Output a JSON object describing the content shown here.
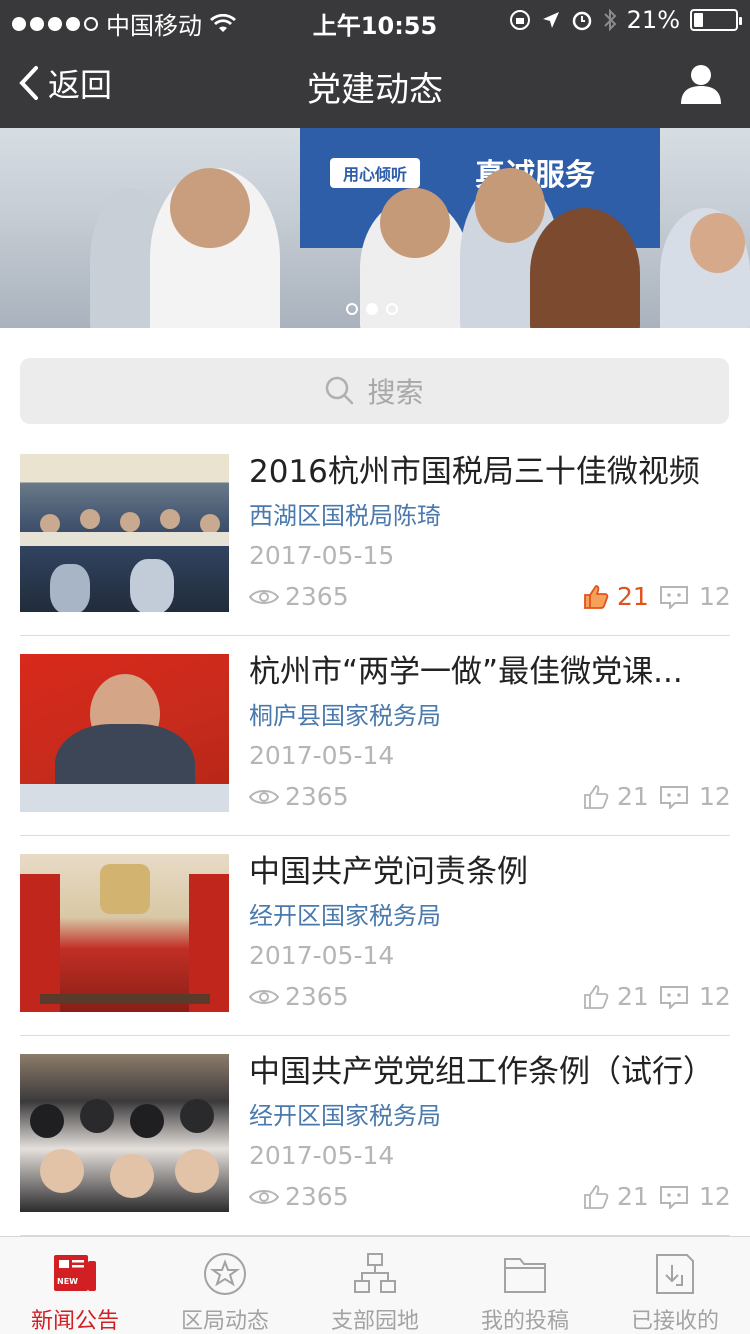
{
  "status_bar": {
    "carrier": "中国移动",
    "time": "上午10:55",
    "battery": "21%",
    "battery_level": 0.21
  },
  "nav": {
    "back_label": "返回",
    "title": "党建动态",
    "icons": {
      "back": "chevron-left-icon",
      "user": "user-icon"
    }
  },
  "banner": {
    "slide_count": 3,
    "active_index": 1,
    "sign_text": "真诚服务",
    "sign_small": "用心倾听"
  },
  "search": {
    "placeholder": "搜索",
    "icon": "search-icon"
  },
  "news": [
    {
      "title": "2016杭州市国税局三十佳微视频",
      "source": "西湖区国税局陈琦",
      "date": "2017-05-15",
      "views": "2365",
      "likes": "21",
      "comments": "12",
      "liked": true
    },
    {
      "title": "杭州市“两学一做”最佳微党课...",
      "source": "桐庐县国家税务局",
      "date": "2017-05-14",
      "views": "2365",
      "likes": "21",
      "comments": "12",
      "liked": false
    },
    {
      "title": "中国共产党问责条例",
      "source": "经开区国家税务局",
      "date": "2017-05-14",
      "views": "2365",
      "likes": "21",
      "comments": "12",
      "liked": false
    },
    {
      "title": "中国共产党党组工作条例（试行）",
      "source": "经开区国家税务局",
      "date": "2017-05-14",
      "views": "2365",
      "likes": "21",
      "comments": "12",
      "liked": false
    }
  ],
  "tabs": [
    {
      "label": "新闻公告",
      "icon": "news-icon",
      "active": true,
      "badge": "NEW"
    },
    {
      "label": "区局动态",
      "icon": "star-refresh-icon",
      "active": false
    },
    {
      "label": "支部园地",
      "icon": "org-chart-icon",
      "active": false
    },
    {
      "label": "我的投稿",
      "icon": "folder-icon",
      "active": false
    },
    {
      "label": "已接收的",
      "icon": "inbox-icon",
      "active": false
    }
  ],
  "colors": {
    "nav_bg": "#39393b",
    "accent_red": "#d21f24",
    "link_blue": "#4a79ad",
    "like_orange": "#e2531b"
  }
}
